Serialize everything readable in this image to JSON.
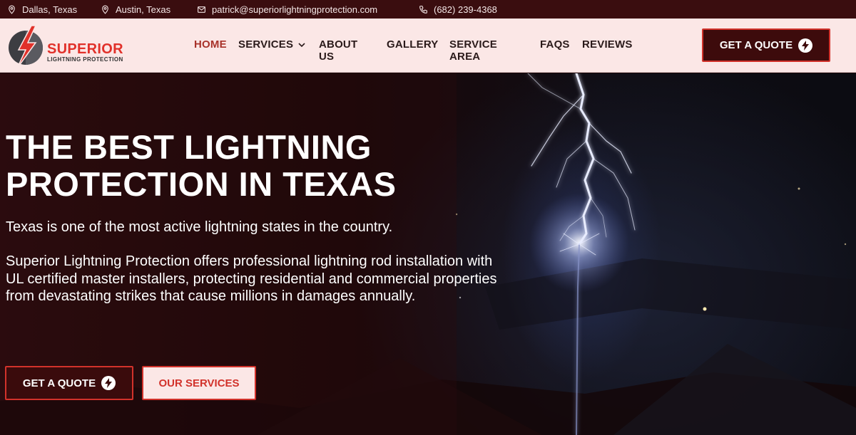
{
  "topbar": {
    "locations": [
      {
        "label": "Dallas, Texas",
        "icon": "map-pin-icon"
      },
      {
        "label": "Austin, Texas",
        "icon": "map-pin-icon"
      }
    ],
    "email": "patrick@superiorlightningprotection.com",
    "phone": "(682) 239-4368"
  },
  "brand": {
    "name": "SUPERIOR",
    "tagline": "LIGHTNING PROTECTION",
    "accent": "#e1312a",
    "dark": "#3d0b0c"
  },
  "nav": {
    "items": [
      {
        "label": "HOME",
        "active": true
      },
      {
        "label": "SERVICES",
        "has_dropdown": true
      },
      {
        "label": "ABOUT US"
      },
      {
        "label": "GALLERY"
      },
      {
        "label": "SERVICE AREA"
      },
      {
        "label": "FAQS"
      },
      {
        "label": "REVIEWS"
      }
    ],
    "cta_label": "GET A QUOTE"
  },
  "hero": {
    "title_line1": "THE BEST LIGHTNING",
    "title_line2": "PROTECTION IN TEXAS",
    "intro": "Texas is one of the most active lightning states in the country.",
    "body": "Superior Lightning Protection offers professional lightning rod installation with UL certified master installers, protecting residential and commercial properties from devastating strikes that cause millions in damages annually.",
    "primary_button": "GET A QUOTE",
    "secondary_button": "OUR SERVICES"
  }
}
